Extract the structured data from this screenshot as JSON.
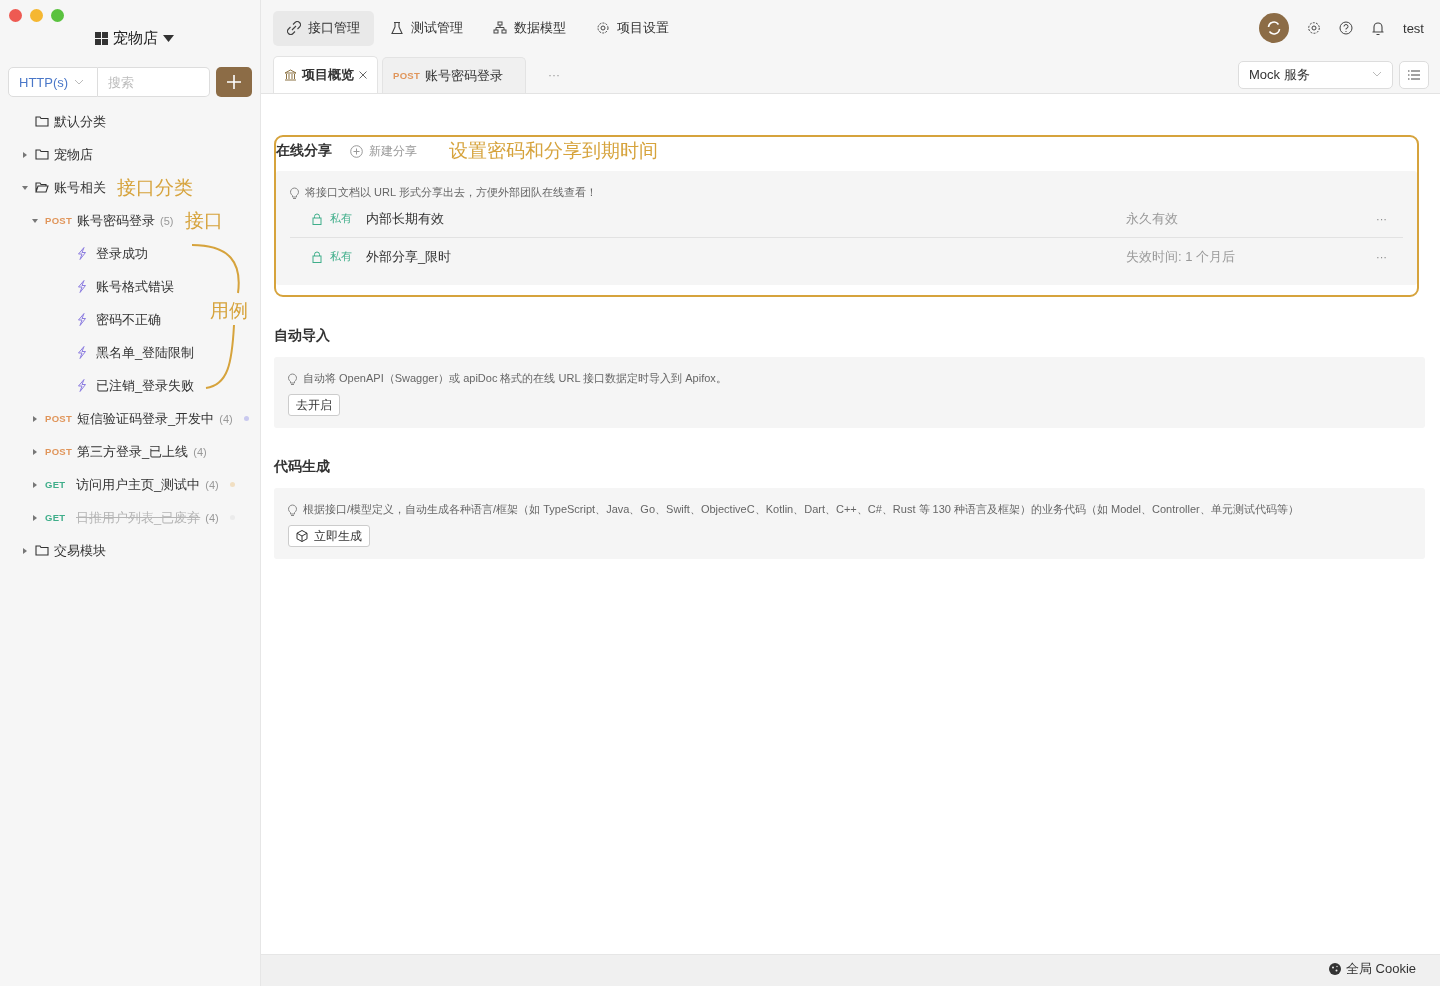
{
  "window": {
    "project": "宠物店"
  },
  "sidebar": {
    "protocol": "HTTP(s)",
    "search_placeholder": "搜索",
    "case_annotation": "用例",
    "tree": [
      {
        "kind": "folder",
        "name": "默认分类"
      },
      {
        "kind": "folder",
        "name": "宠物店",
        "expanded": false
      },
      {
        "kind": "folder",
        "name": "账号相关",
        "expanded": true,
        "annotation": "接口分类",
        "children": [
          {
            "kind": "api",
            "method": "POST",
            "name": "账号密码登录",
            "count": "(5)",
            "expanded": true,
            "annotation": "接口",
            "children": [
              {
                "kind": "case",
                "name": "登录成功"
              },
              {
                "kind": "case",
                "name": "账号格式错误"
              },
              {
                "kind": "case",
                "name": "密码不正确"
              },
              {
                "kind": "case",
                "name": "黑名单_登陆限制"
              },
              {
                "kind": "case",
                "name": "已注销_登录失败"
              }
            ]
          },
          {
            "kind": "api",
            "method": "POST",
            "name": "短信验证码登录_开发中",
            "count": "(4)",
            "expanded": false,
            "color": "#c9c9ef"
          },
          {
            "kind": "api",
            "method": "POST",
            "name": "第三方登录_已上线",
            "count": "(4)",
            "expanded": false
          },
          {
            "kind": "api",
            "method": "GET",
            "name": "访问用户主页_测试中",
            "count": "(4)",
            "expanded": false,
            "color": "#f1dfc2"
          },
          {
            "kind": "api",
            "method": "GET",
            "name": "日推用户列表_已废弃",
            "count": "(4)",
            "expanded": false,
            "deprecated": true,
            "color": "#ebebeb"
          }
        ]
      },
      {
        "kind": "folder",
        "name": "交易模块",
        "expanded": false
      }
    ]
  },
  "nav_tabs": [
    {
      "label": "接口管理",
      "selected": true
    },
    {
      "label": "测试管理",
      "selected": false
    },
    {
      "label": "数据模型",
      "selected": false
    },
    {
      "label": "项目设置",
      "selected": false
    }
  ],
  "user": "test",
  "doc_tabs": [
    {
      "label": "项目概览",
      "selected": true,
      "closable": true
    },
    {
      "method": "POST",
      "label": "账号密码登录",
      "selected": false,
      "closable": false
    }
  ],
  "more_tabs": "···",
  "mock": "Mock 服务",
  "share": {
    "title": "在线分享",
    "new_share": "新建分享",
    "annotation": "设置密码和分享到期时间",
    "note": "将接口文档以 URL 形式分享出去，方便外部团队在线查看！",
    "rows": [
      {
        "visibility": "私有",
        "name": "内部长期有效",
        "expiry": "永久有效",
        "menu": "···"
      },
      {
        "visibility": "私有",
        "name": "外部分享_限时",
        "expiry": "失效时间: 1 个月后",
        "menu": "···"
      }
    ]
  },
  "auto_import": {
    "title": "自动导入",
    "note": "自动将 OpenAPI（Swagger）或 apiDoc 格式的在线 URL 接口数据定时导入到 Apifox。",
    "button": "去开启"
  },
  "codegen": {
    "title": "代码生成",
    "note": "根据接口/模型定义，自动生成各种语言/框架（如 TypeScript、Java、Go、Swift、ObjectiveC、Kotlin、Dart、C++、C#、Rust 等 130 种语言及框架）的业务代码（如 Model、Controller、单元测试代码等）",
    "button": "立即生成"
  },
  "status_bar": {
    "cookie": "全局 Cookie"
  }
}
